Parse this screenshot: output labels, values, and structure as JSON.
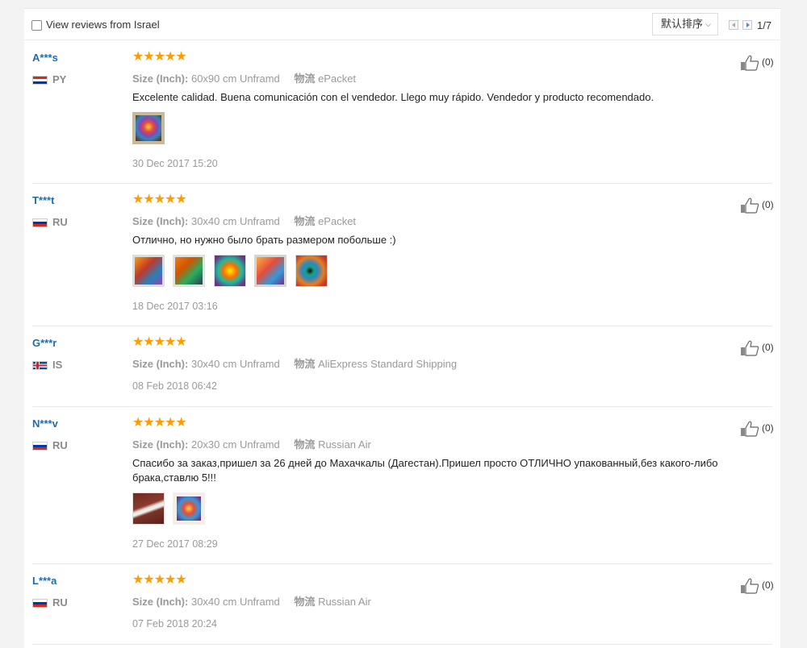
{
  "filter": {
    "checkbox_label": "View reviews from Israel",
    "sort_label": "默认排序",
    "page": "1/7"
  },
  "reviews": [
    {
      "name": "A***s",
      "country": "PY",
      "stars": "★★★★★",
      "size_label": "Size (Inch):",
      "size_value": "60x90 cm Unframd",
      "ship_label": "物流",
      "ship_value": "ePacket",
      "text": "Excelente calidad. Buena comunicación con el vendedor. Llego muy rápido. Vendedor y producto recomendado.",
      "date": "30 Dec 2017 15:20",
      "helpful": "(0)"
    },
    {
      "name": "T***t",
      "country": "RU",
      "stars": "★★★★★",
      "size_label": "Size (Inch):",
      "size_value": "30x40 cm Unframd",
      "ship_label": "物流",
      "ship_value": "ePacket",
      "text": "Отлично, но нужно было брать размером побольше :)",
      "date": "18 Dec 2017 03:16",
      "helpful": "(0)"
    },
    {
      "name": "G***r",
      "country": "IS",
      "stars": "★★★★★",
      "size_label": "Size (Inch):",
      "size_value": "30x40 cm Unframd",
      "ship_label": "物流",
      "ship_value": "AliExpress Standard Shipping",
      "date": "08 Feb 2018 06:42",
      "helpful": "(0)"
    },
    {
      "name": "N***v",
      "country": "RU",
      "stars": "★★★★★",
      "size_label": "Size (Inch):",
      "size_value": "20x30 cm Unframd",
      "ship_label": "物流",
      "ship_value": "Russian Air",
      "text": "Спасибо за заказ,пришел за 26 дней до Махачкалы (Дагестан).Пришел просто ОТЛИЧНО упакованный,без какого-либо брака,ставлю 5!!!",
      "date": "27 Dec 2017 08:29",
      "helpful": "(0)"
    },
    {
      "name": "L***a",
      "country": "RU",
      "stars": "★★★★★",
      "size_label": "Size (Inch):",
      "size_value": "30x40 cm Unframd",
      "ship_label": "物流",
      "ship_value": "Russian Air",
      "date": "07 Feb 2018 20:24",
      "helpful": "(0)"
    }
  ],
  "icons": {
    "helpful": "thumbs-up-icon",
    "star": "star-icon"
  },
  "colors": {
    "name": "#1a6cb3",
    "stars": "#ff9c00"
  }
}
